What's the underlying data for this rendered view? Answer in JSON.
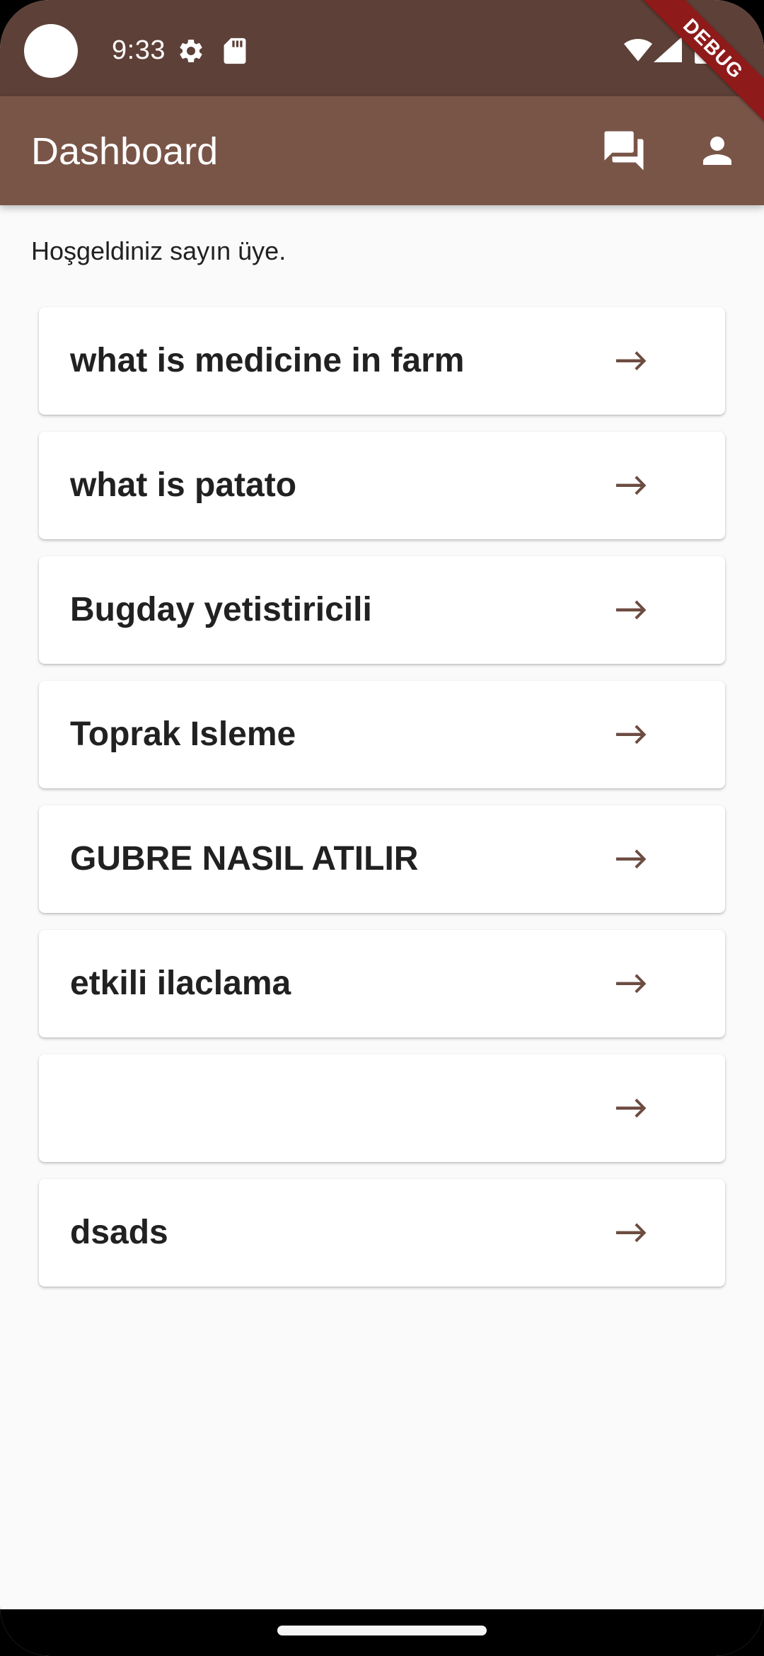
{
  "status_bar": {
    "time": "9:33",
    "icons": [
      "settings-gear-icon",
      "sd-card-icon",
      "wifi-icon",
      "cellular-signal-icon",
      "battery-icon"
    ]
  },
  "app_bar": {
    "title": "Dashboard",
    "actions": [
      "forum-icon",
      "person-icon"
    ]
  },
  "debug_banner": "DEBUG",
  "welcome_text": "Hoşgeldiniz sayın üye.",
  "questions": [
    {
      "title": "what is medicine in farm"
    },
    {
      "title": "what is patato"
    },
    {
      "title": "Bugday yetistiricili"
    },
    {
      "title": "Toprak Isleme"
    },
    {
      "title": "GUBRE NASIL ATILIR"
    },
    {
      "title": "etkili ilaclama"
    },
    {
      "title": ""
    },
    {
      "title": "dsads"
    }
  ],
  "colors": {
    "status_bar": "#5d4037",
    "app_bar": "#795548",
    "arrow": "#6d4c41",
    "background": "#fafafa",
    "debug": "#8e1a1a"
  }
}
